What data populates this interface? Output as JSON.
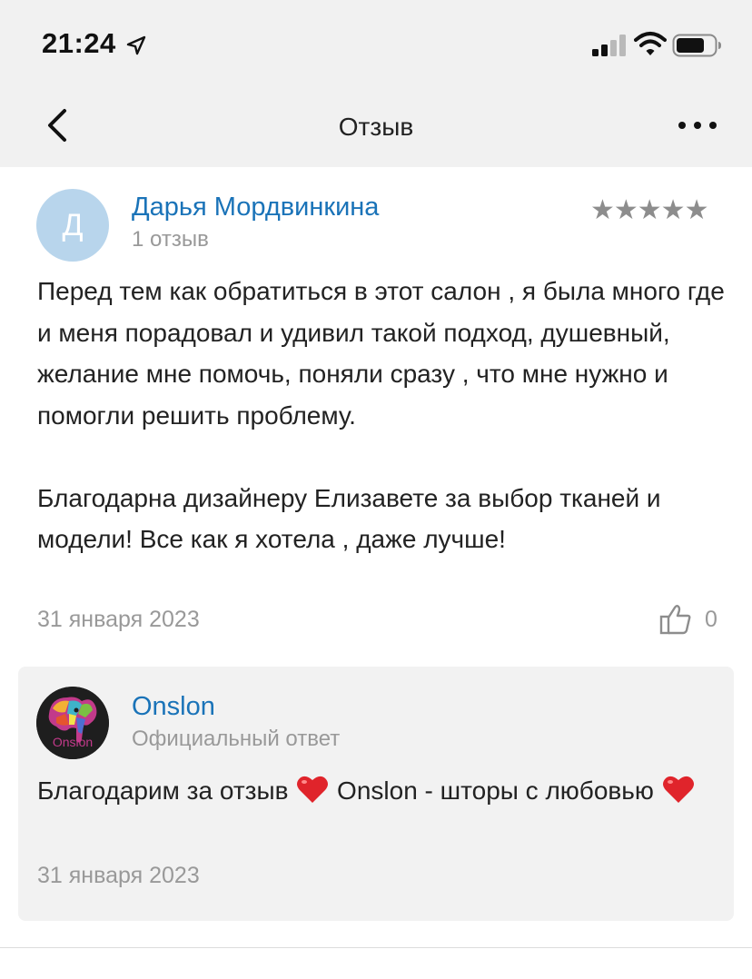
{
  "status": {
    "time": "21:24"
  },
  "nav": {
    "title": "Отзыв"
  },
  "review": {
    "avatar_letter": "Д",
    "author": "Дарья Мордвинкина",
    "review_count": "1 отзыв",
    "stars": "★★★★★",
    "rating": 5,
    "text_p1": "Перед тем как обратиться в этот салон , я была много где и меня порадовал и удивил такой подход, душевный, желание мне помочь, поняли сразу , что мне нужно и помогли решить проблему.",
    "text_p2": "Благодарна дизайнеру Елизавете за выбор тканей и модели! Все как я хотела , даже лучше!",
    "date": "31 января 2023",
    "likes": "0"
  },
  "reply": {
    "brand": "Onslon",
    "label": "Официальный ответ",
    "text_a": "Благодарим за отзыв ",
    "text_b": " Onslon - шторы с любовью ",
    "date": "31 января 2023",
    "logo_text": "Onslon"
  },
  "colors": {
    "link": "#1a73b8",
    "muted": "#999999",
    "header_bg": "#f1f1f1",
    "reply_bg": "#f2f2f2",
    "avatar_bg": "#b8d5ec",
    "heart": "#e0242b"
  }
}
